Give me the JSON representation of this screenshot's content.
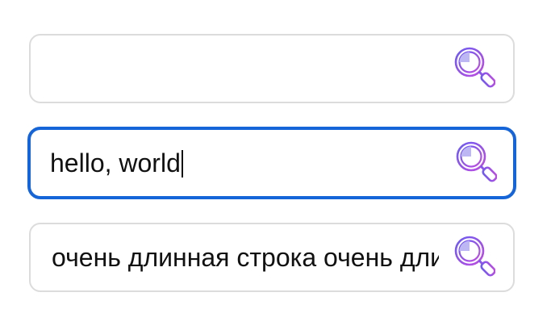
{
  "fields": [
    {
      "value": "",
      "focused": false
    },
    {
      "value": "hello, world",
      "focused": true
    },
    {
      "value": "очень длинная строка очень длинная строка",
      "focused": false
    }
  ],
  "icons": {
    "search": "magnifier-icon"
  },
  "colors": {
    "focus_border": "#1565d8",
    "idle_border": "#dcdcdc",
    "icon_gradient_start": "#6a5cf0",
    "icon_gradient_end": "#c04ce0",
    "icon_fill": "#bdb7f4"
  }
}
